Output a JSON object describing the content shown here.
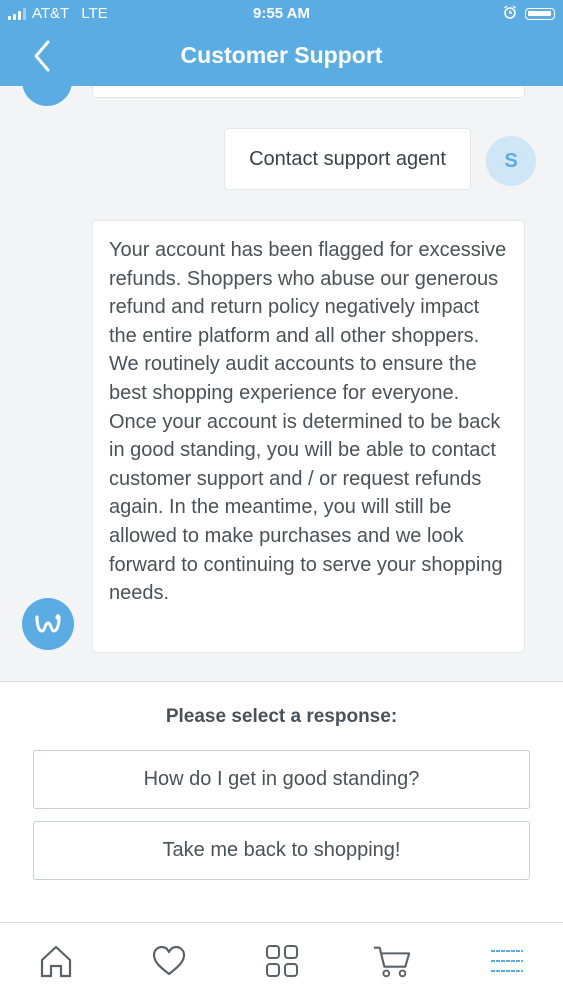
{
  "status_bar": {
    "carrier": "AT&T",
    "network": "LTE",
    "time": "9:55 AM"
  },
  "header": {
    "title": "Customer Support"
  },
  "chat": {
    "user_message": "Contact support agent",
    "user_initial": "S",
    "agent_message": "Your account has been flagged for excessive refunds. Shoppers who abuse our generous refund and return policy negatively impact the entire platform and all other shoppers. We routinely audit accounts to ensure the best shopping experience for everyone. Once your account is determined to be back in good standing, you will be able to contact customer support and / or request refunds again. In the meantime, you will still be allowed to make purchases and we look forward to continuing to serve your shopping needs.",
    "agent_avatar_icon": "wish-logo-icon"
  },
  "responses": {
    "prompt": "Please select a response:",
    "options": [
      "How do I get in good standing?",
      "Take me back to shopping!"
    ]
  },
  "tabbar": {
    "items": [
      "home-icon",
      "heart-icon",
      "grid-icon",
      "cart-icon",
      "menu-icon"
    ],
    "active_index": 4
  },
  "colors": {
    "brand": "#5aace3",
    "text": "#4a5258",
    "background": "#f3f4f5"
  }
}
